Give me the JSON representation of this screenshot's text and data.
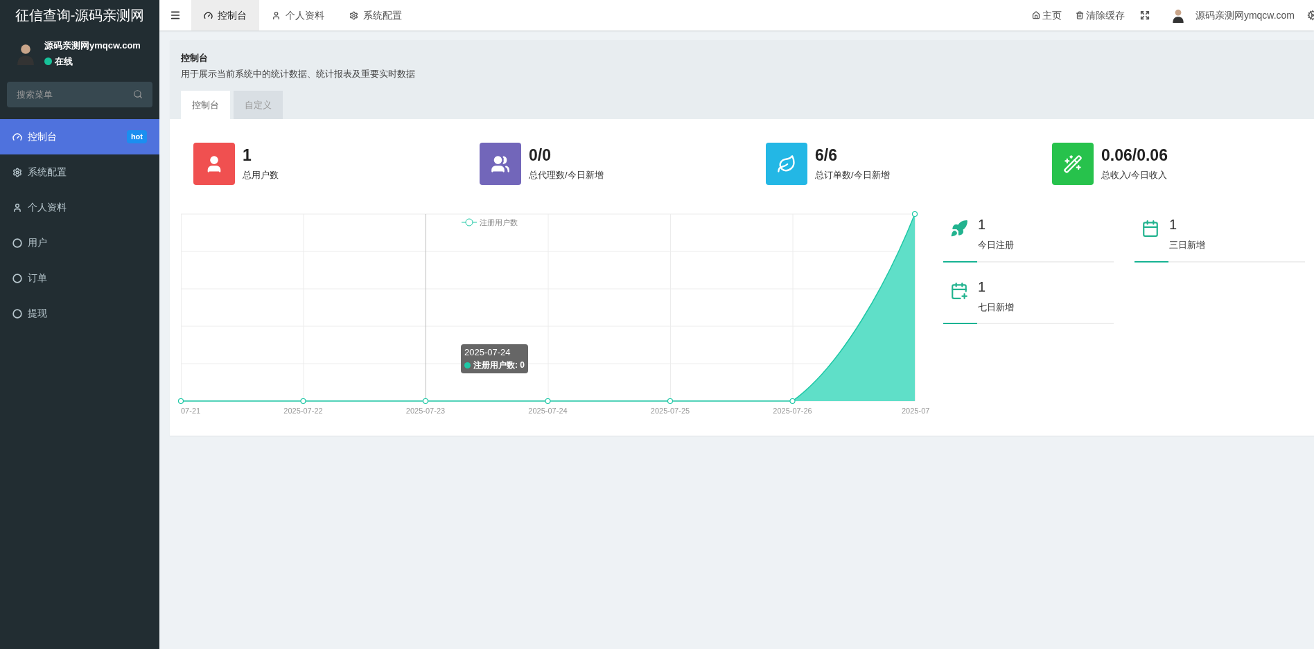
{
  "app_title": "征信查询-源码亲测网",
  "user": {
    "name": "源码亲测网ymqcw.com",
    "status": "在线",
    "online": true
  },
  "search": {
    "placeholder": "搜索菜单"
  },
  "menu": [
    {
      "label": "控制台",
      "selected": true,
      "badge": "hot"
    },
    {
      "label": "系统配置",
      "selected": false
    },
    {
      "label": "个人资料",
      "selected": false
    },
    {
      "label": "用户",
      "selected": false
    },
    {
      "label": "订单",
      "selected": false
    },
    {
      "label": "提现",
      "selected": false
    }
  ],
  "topbar": {
    "tabs": [
      {
        "label": "控制台",
        "selected": true
      },
      {
        "label": "个人资料",
        "selected": false
      },
      {
        "label": "系统配置",
        "selected": false
      }
    ],
    "links": [
      {
        "label": "主页"
      },
      {
        "label": "清除缓存"
      }
    ],
    "username": "源码亲测网ymqcw.com"
  },
  "panel": {
    "title": "控制台",
    "description": "用于展示当前系统中的统计数据、统计报表及重要实时数据",
    "tabs": [
      {
        "label": "控制台",
        "selected": true
      },
      {
        "label": "自定义",
        "selected": false
      }
    ]
  },
  "stats": [
    {
      "value": "1",
      "label": "总用户数",
      "color": "#f05050"
    },
    {
      "value": "0/0",
      "label": "总代理数/今日新增",
      "color": "#7266ba"
    },
    {
      "value": "6/6",
      "label": "总订单数/今日新增",
      "color": "#23b7e5"
    },
    {
      "value": "0.06/0.06",
      "label": "总收入/今日收入",
      "color": "#27c24c"
    }
  ],
  "chart": {
    "legend": "注册用户数",
    "x_labels": [
      "07-21",
      "2025-07-22",
      "2025-07-23",
      "2025-07-24",
      "2025-07-25",
      "2025-07-26",
      "2025-07"
    ],
    "tooltip": {
      "title": "2025-07-24",
      "label": "注册用户数: 0"
    }
  },
  "mini_stats": [
    {
      "value": "1",
      "label": "今日注册"
    },
    {
      "value": "1",
      "label": "三日新增"
    },
    {
      "value": "1",
      "label": "七日新增"
    }
  ]
}
